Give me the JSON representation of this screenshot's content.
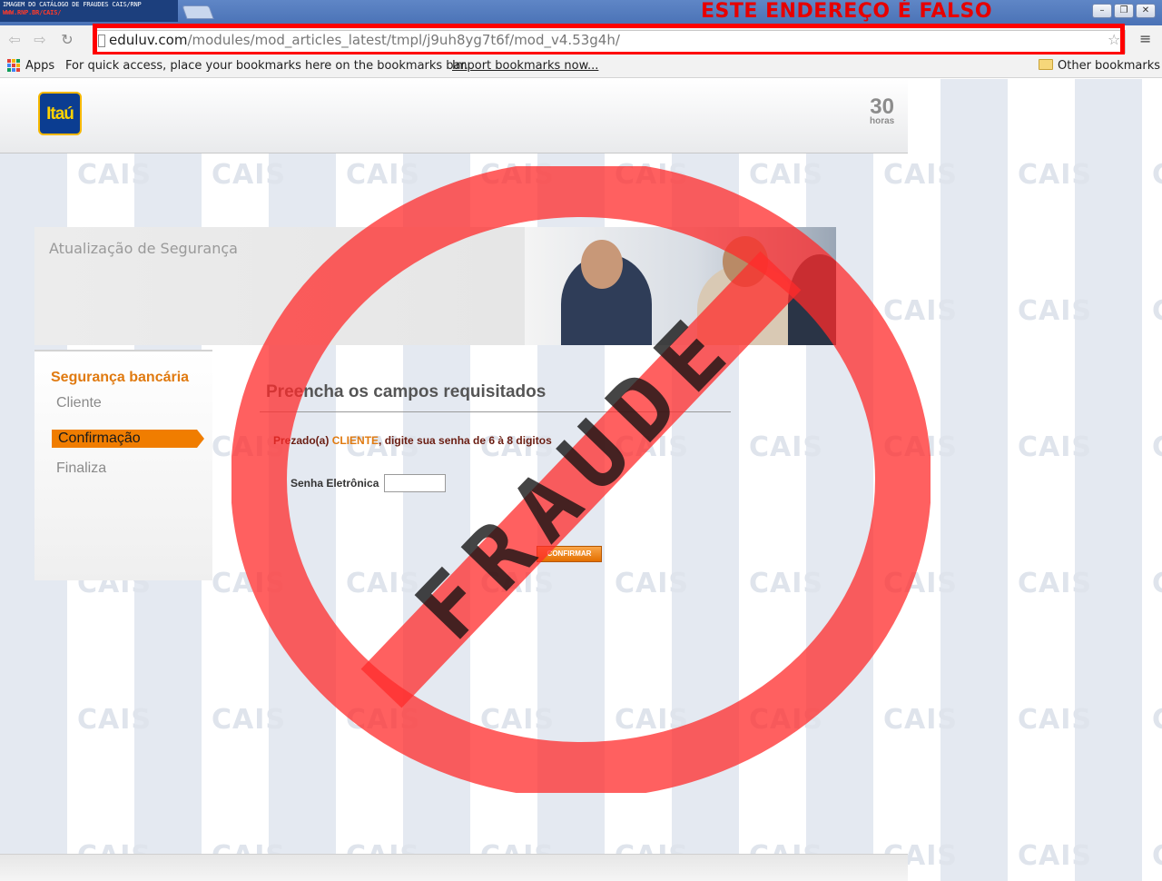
{
  "browser": {
    "tab_caption": "IMAGEM DO CATÁLOGO DE FRAUDES CAIS/RNP",
    "tab_caption_sub": "WWW.RNP.BR/CAIS/",
    "url_host": "eduluv.com",
    "url_path": "/modules/mod_articles_latest/tmpl/j9uh8yg7t6f/mod_v4.53g4h/",
    "warning_label": "ESTE ENDEREÇO É FALSO",
    "bookmarks": {
      "apps": "Apps",
      "hint": "For quick access, place your bookmarks here on the bookmarks bar.",
      "import": "Import bookmarks now...",
      "other": "Other bookmarks"
    }
  },
  "watermark": "CAIS",
  "stamp_text": "FRAUDE",
  "header": {
    "logo_text": "Itaú",
    "badge_number": "30",
    "badge_label": "horas"
  },
  "banner": {
    "title": "Atualização de Segurança"
  },
  "sidebar": {
    "title": "Segurança bancária",
    "items": [
      {
        "label": "Cliente"
      },
      {
        "label": "Confirmação"
      },
      {
        "label": "Finaliza"
      }
    ]
  },
  "form": {
    "title": "Preencha os campos requisitados",
    "msg_prefix": "Prezado(a) ",
    "msg_client": "CLIENTE",
    "msg_suffix": ", digite sua senha de 6 à 8 digitos",
    "password_label": "Senha Eletrônica",
    "confirm_label": "CONFIRMAR"
  },
  "colors": {
    "accent": "#f07d00",
    "warning": "#ff0000",
    "brand": "#0b3d91"
  }
}
